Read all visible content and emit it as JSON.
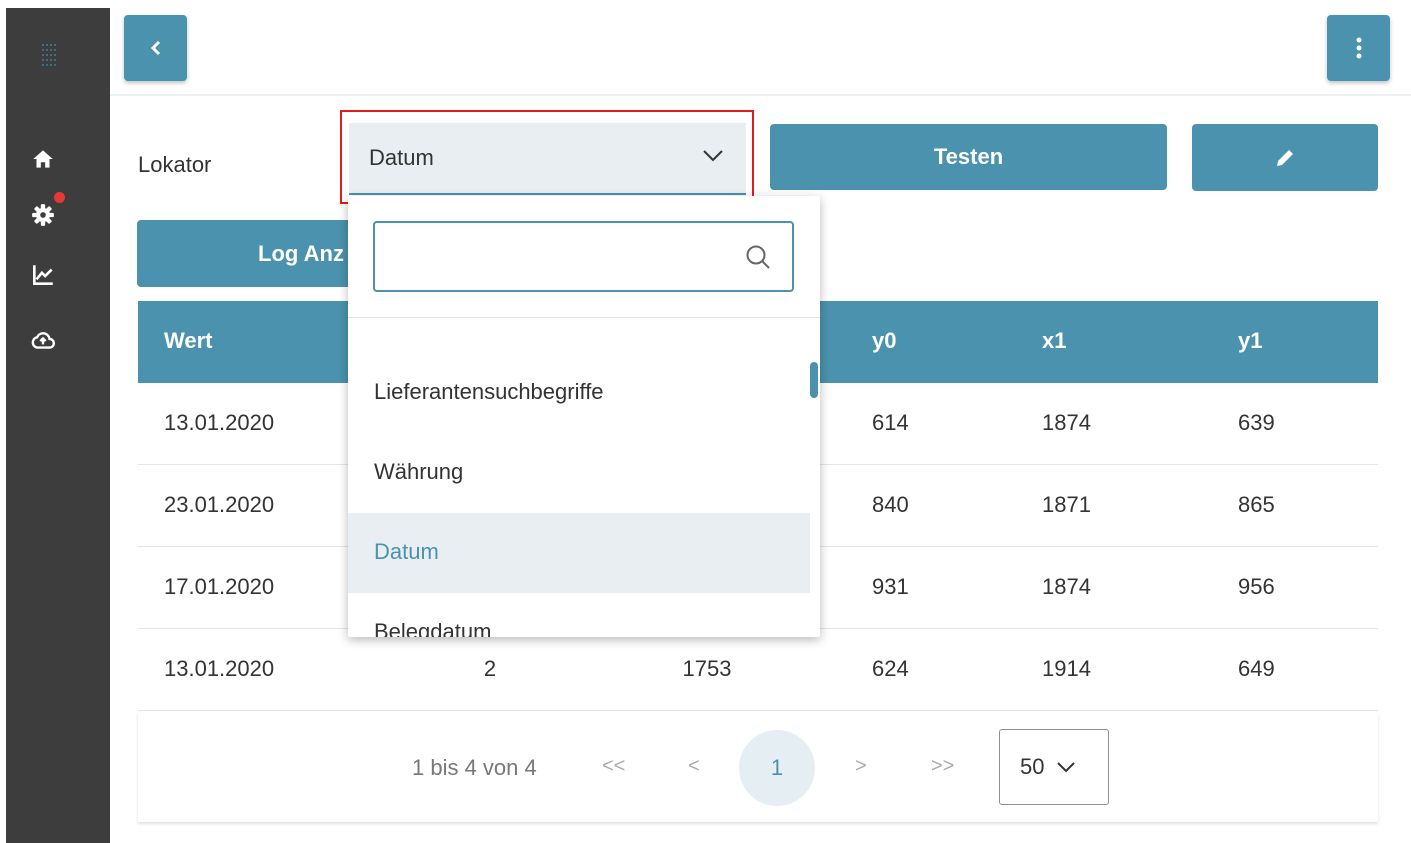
{
  "sidebar": {
    "items": [
      {
        "icon": "home-icon"
      },
      {
        "icon": "gear-icon",
        "has_notification": true
      },
      {
        "icon": "chart-icon"
      },
      {
        "icon": "cloud-upload-icon"
      }
    ]
  },
  "topbar": {
    "back_icon": "chevron-left-icon",
    "menu_icon": "kebab-menu-icon"
  },
  "form": {
    "lokator_label": "Lokator",
    "lokator_value": "Datum",
    "test_button": "Testen",
    "edit_icon": "pencil-icon",
    "log_button": "Log Anz"
  },
  "table": {
    "headers": [
      "Wert",
      "y0",
      "x1",
      "y1"
    ],
    "rows": [
      {
        "wert": "13.01.2020",
        "y0": "614",
        "x1": "1874",
        "y1": "639"
      },
      {
        "wert": "23.01.2020",
        "y0": "840",
        "x1": "1871",
        "y1": "865"
      },
      {
        "wert": "17.01.2020",
        "y0": "931",
        "x1": "1874",
        "y1": "956"
      },
      {
        "wert": "13.01.2020",
        "col2": "2",
        "col3": "1753",
        "y0": "624",
        "x1": "1914",
        "y1": "649"
      }
    ]
  },
  "pagination": {
    "range_text": "1 bis 4 von 4",
    "first": "<<",
    "prev": "<",
    "current_page": "1",
    "next": ">",
    "last": ">>",
    "page_size": "50"
  },
  "dropdown": {
    "search_placeholder": "",
    "options": [
      "Lieferantensuchbegriffe",
      "Währung",
      "Datum",
      "Belegdatum"
    ],
    "selected": "Datum"
  },
  "colors": {
    "accent": "#4a92ad",
    "sidebar": "#3d3d3d",
    "highlight": "#e21b1b",
    "notification": "#e53935"
  }
}
